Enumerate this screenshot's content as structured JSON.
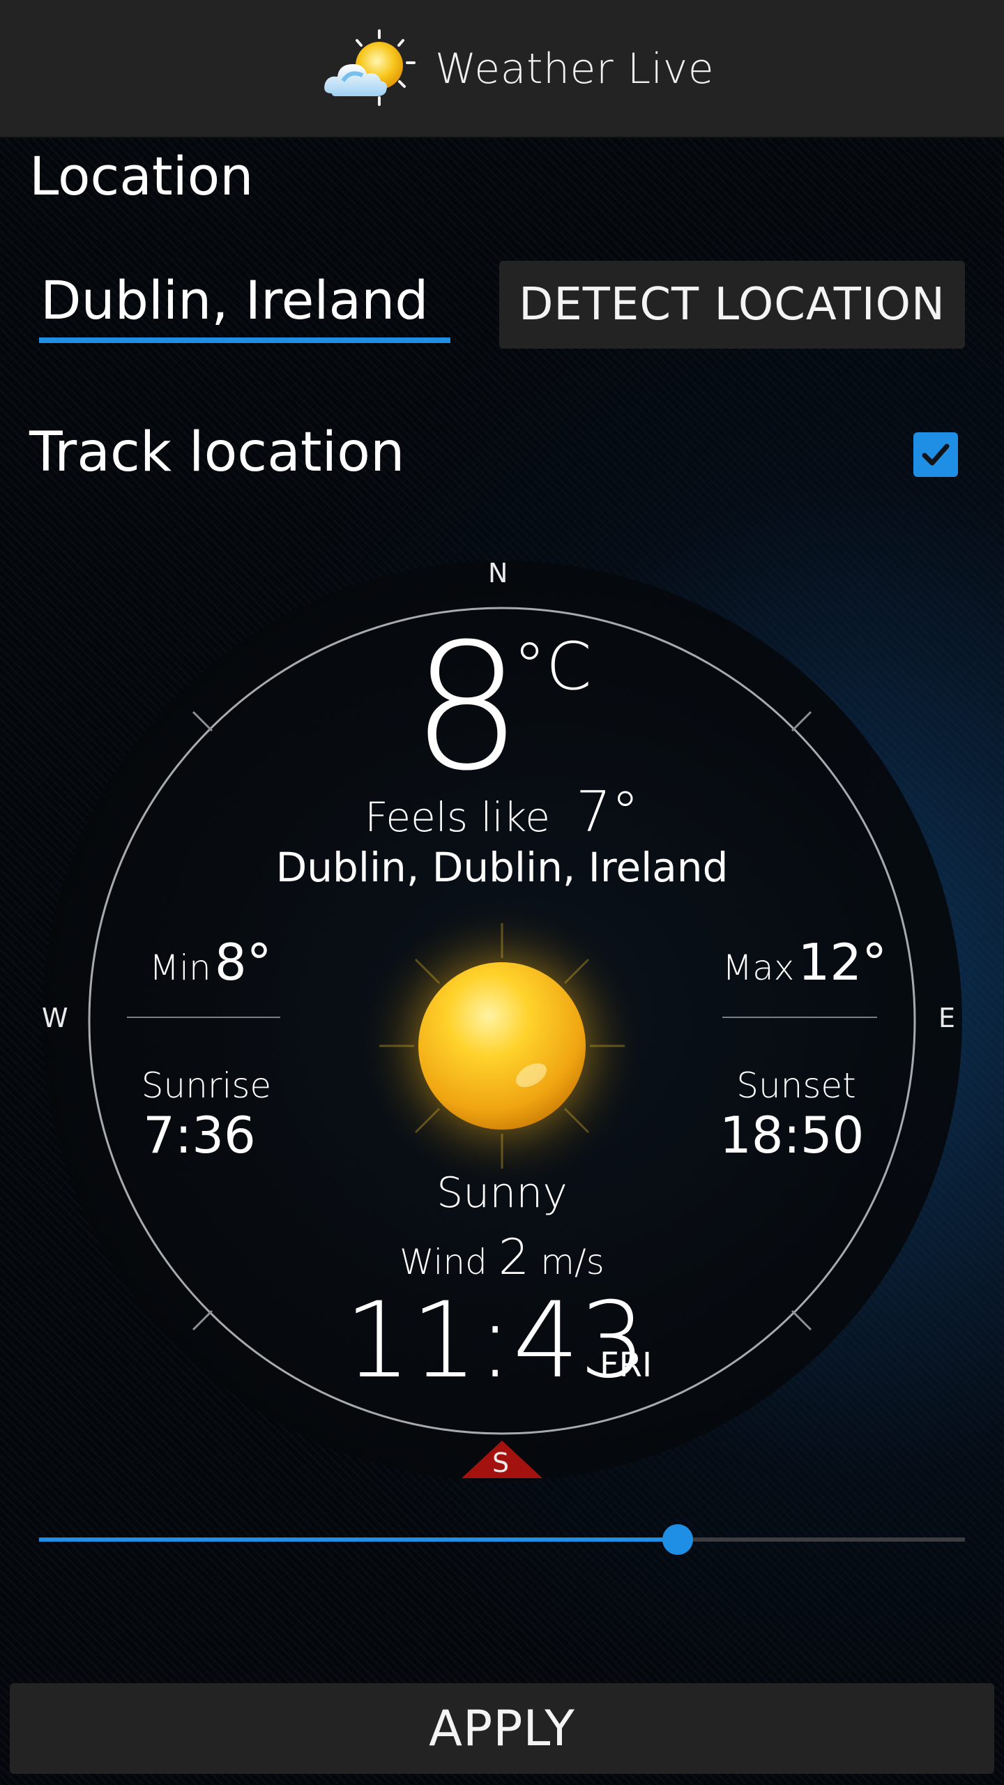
{
  "app": {
    "title": "Weather Live",
    "icon": "sun-cloud-logo-icon"
  },
  "location_section": {
    "title": "Location",
    "input_value": "Dublin, Ireland",
    "detect_button": "DETECT LOCATION",
    "track_label": "Track location",
    "track_checked": true
  },
  "weather": {
    "temperature": "8",
    "unit": "°C",
    "feels_like_label": "Feels like",
    "feels_like_value": "7°",
    "city": "Dublin, Dublin, Ireland",
    "min_label": "Min",
    "min_value": "8°",
    "max_label": "Max",
    "max_value": "12°",
    "sunrise_label": "Sunrise",
    "sunrise_value": "7:36",
    "sunset_label": "Sunset",
    "sunset_value": "18:50",
    "condition": "Sunny",
    "condition_icon": "sun-icon",
    "wind_label": "Wind",
    "wind_value": "2",
    "wind_unit": "m/s",
    "time": "11:43",
    "day": "FRI"
  },
  "compass": {
    "north": "N",
    "south": "S",
    "east": "E",
    "west": "W"
  },
  "slider": {
    "value_fraction": 0.69
  },
  "footer": {
    "apply_button": "APPLY"
  },
  "colors": {
    "accent": "#1f8fe6",
    "bar": "#232323",
    "south_marker": "#a3120f",
    "sun": "#f6b716"
  }
}
